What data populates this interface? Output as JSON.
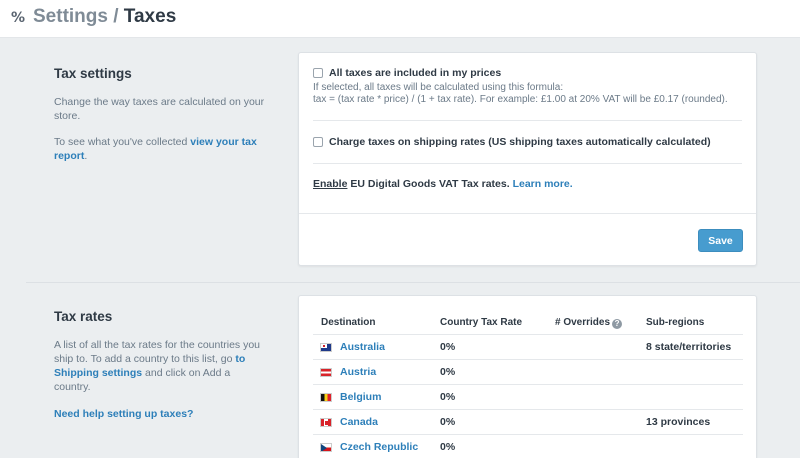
{
  "header": {
    "parent": "Settings",
    "separator": "/",
    "title": "Taxes"
  },
  "tax_settings": {
    "heading": "Tax settings",
    "description": "Change the way taxes are calculated on your store.",
    "collected_prefix": "To see what you've collected",
    "collected_link": "view your tax report",
    "collected_suffix": ".",
    "included": {
      "label": "All taxes are included in my prices",
      "checked": false,
      "help_line1": "If selected, all taxes will be calculated using this formula:",
      "help_line2": "tax = (tax rate * price) / (1 + tax rate). For example: £1.00 at 20% VAT will be £0.17 (rounded)."
    },
    "shipping": {
      "label": "Charge taxes on shipping rates (US shipping taxes automatically calculated)",
      "checked": false
    },
    "eu": {
      "enable": "Enable",
      "text": "EU Digital Goods VAT Tax rates.",
      "learn_more": "Learn more."
    },
    "save_label": "Save"
  },
  "tax_rates": {
    "heading": "Tax rates",
    "description_prefix": "A list of all the tax rates for the countries you ship to. To add a country to this list, go",
    "shipping_link": "to Shipping settings",
    "description_suffix": "and click on Add a country.",
    "help_link": "Need help setting up taxes?",
    "columns": {
      "destination": "Destination",
      "country_rate": "Country Tax Rate",
      "overrides": "# Overrides",
      "subregions": "Sub-regions"
    },
    "rows": [
      {
        "country": "Australia",
        "rate": "0%",
        "subregions": "8 state/territories",
        "flag": "australia-flag-icon"
      },
      {
        "country": "Austria",
        "rate": "0%",
        "subregions": "",
        "flag": "austria-flag-icon"
      },
      {
        "country": "Belgium",
        "rate": "0%",
        "subregions": "",
        "flag": "belgium-flag-icon"
      },
      {
        "country": "Canada",
        "rate": "0%",
        "subregions": "13 provinces",
        "flag": "canada-flag-icon"
      },
      {
        "country": "Czech Republic",
        "rate": "0%",
        "subregions": "",
        "flag": "czech-republic-flag-icon"
      }
    ]
  },
  "colors": {
    "accent": "#479ccf",
    "link": "#2d7fb9",
    "background": "#ebeef0"
  }
}
